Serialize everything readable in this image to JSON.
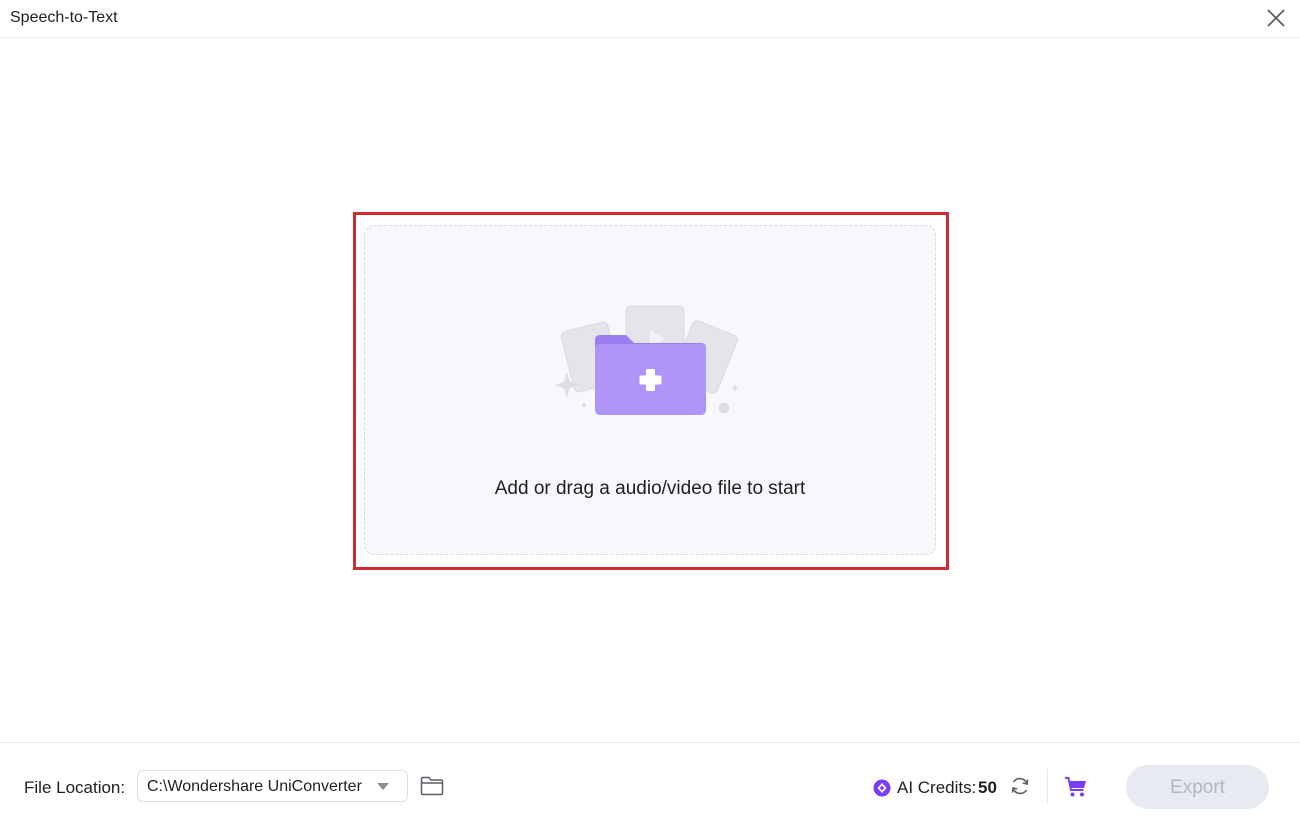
{
  "window": {
    "title": "Speech-to-Text",
    "close_icon": "close-icon"
  },
  "dropzone": {
    "text": "Add or drag a audio/video file to start",
    "icon": "add-folder-icon",
    "accent_color": "#a98af6"
  },
  "footer": {
    "file_location_label": "File Location:",
    "file_location_value": "C:\\Wondershare UniConverter",
    "folder_icon": "folder-icon",
    "credits_label": "AI Credits:",
    "credits_value": "50",
    "refresh_icon": "refresh-icon",
    "cart_icon": "cart-icon",
    "export_label": "Export"
  },
  "colors": {
    "highlight_border": "#d12b33",
    "brand_purple": "#7b3cf5",
    "export_disabled_bg": "#e8eaf1"
  }
}
